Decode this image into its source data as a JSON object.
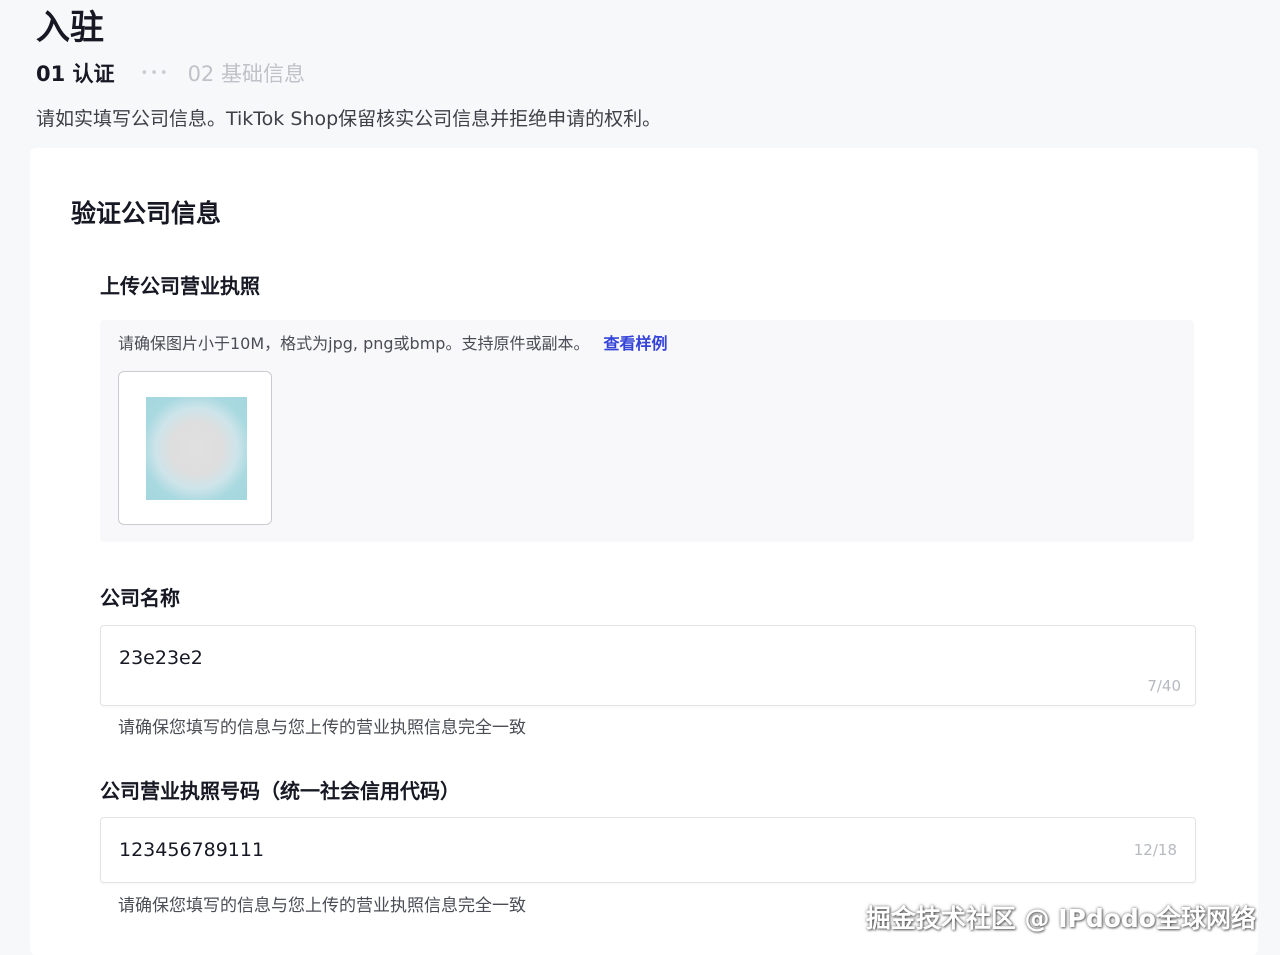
{
  "header": {
    "title": "入驻"
  },
  "stepper": {
    "step1": "01 认证",
    "step2": "02 基础信息"
  },
  "intro_text": "请如实填写公司信息。TikTok Shop保留核实公司信息并拒绝申请的权利。",
  "form": {
    "section_title": "验证公司信息",
    "license_upload": {
      "label": "上传公司营业执照",
      "hint": "请确保图片小于10M，格式为jpg, png或bmp。支持原件或副本。",
      "sample_link": "查看样例"
    },
    "company_name": {
      "label": "公司名称",
      "value": "23e23e2",
      "counter": "7/40",
      "help": "请确保您填写的信息与您上传的营业执照信息完全一致"
    },
    "license_number": {
      "label": "公司营业执照号码（统一社会信用代码）",
      "value": "123456789111",
      "counter": "12/18",
      "help": "请确保您填写的信息与您上传的营业执照信息完全一致"
    }
  },
  "watermark": "掘金技术社区 @ IPdodo全球网络"
}
